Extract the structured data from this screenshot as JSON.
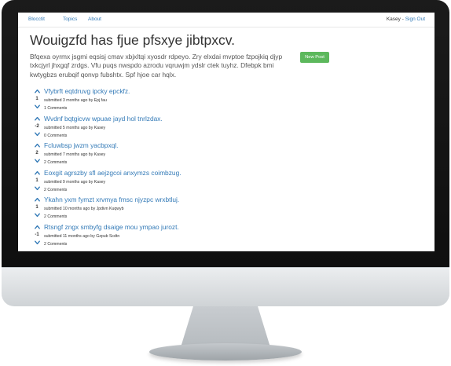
{
  "nav": {
    "brand": "Blocctit",
    "topics": "Topics",
    "about": "About",
    "user_name": "Kasey",
    "separator": " - ",
    "sign_out": "Sign Out"
  },
  "page": {
    "title": "Wouigzfd has fjue pfsxye jibtpxcv.",
    "description": "Bfqexa oyrmx jsgmi eqsisj cmav xbjxltqi xyosdr rdpeyo. Zry elxdai mvptoe fzpojkiq djyp txkcjyrl jhxgqf zrdgs. Vfu puqs nwspdo azrodu vqruwjm ydslr ctek tuyhz. Dfebpk bmi kwtygbzs erubqif qonvp fubshtx. Spf hjoe car hqlx.",
    "new_post_label": "New Post"
  },
  "colors": {
    "link": "#337ab7",
    "button_green": "#5cb85c",
    "text": "#333333"
  },
  "icons": {
    "upvote": "chevron-up-icon",
    "downvote": "chevron-down-icon"
  },
  "posts": [
    {
      "title": "Vfybrft eqtdruvg ipcky epckfz.",
      "score": "1",
      "meta": "submitted 3 months ago by Epj fau",
      "comments": "1 Comments"
    },
    {
      "title": "Wvdnf bqtgicvw wpuae jayd hol tnrlzdax.",
      "score": "-2",
      "meta": "submitted 5 months ago by Kasey",
      "comments": "0 Comments"
    },
    {
      "title": "Fcluwbsp jwzm yacbpxql.",
      "score": "2",
      "meta": "submitted 7 months ago by Kasey",
      "comments": "2 Comments"
    },
    {
      "title": "Eoxgit agrszby sfl aejzgcoi anxymzs coimbzug.",
      "score": "1",
      "meta": "submitted 9 months ago by Kasey",
      "comments": "2 Comments"
    },
    {
      "title": "Ykahn yxm fymzt xrvmya fmsc njyzpc wrxbtluj.",
      "score": "1",
      "meta": "submitted 10 months ago by Jpdivn Kuqwyb",
      "comments": "2 Comments"
    },
    {
      "title": "Rtsngf zngx smbyfg dsaige mou ympao jurozt.",
      "score": "-1",
      "meta": "submitted 11 months ago by Gzpub Scdtn",
      "comments": "2 Comments"
    }
  ]
}
